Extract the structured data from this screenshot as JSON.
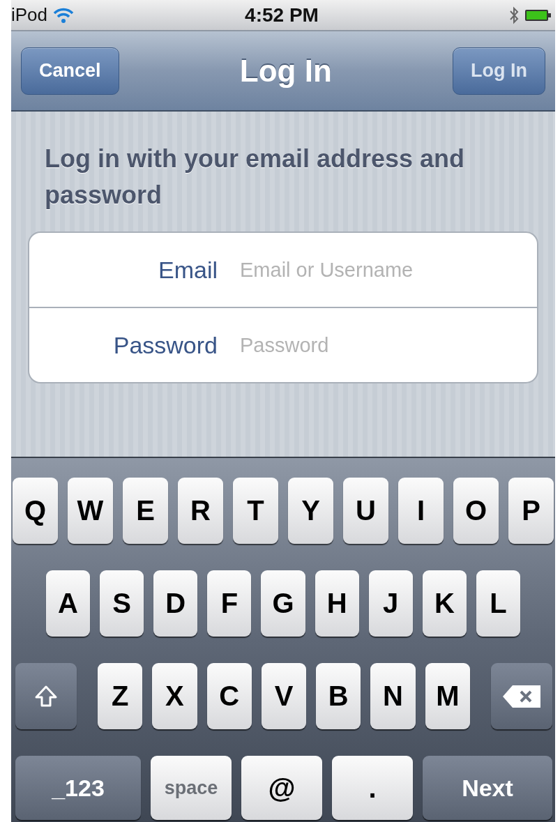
{
  "status_bar": {
    "carrier": "iPod",
    "time": "4:52 PM"
  },
  "nav_bar": {
    "left_button": "Cancel",
    "title": "Log In",
    "right_button": "Log In"
  },
  "instructions": "Log in with your email address and password",
  "fields": [
    {
      "label": "Email",
      "placeholder": "Email or Username"
    },
    {
      "label": "Password",
      "placeholder": "Password"
    }
  ],
  "keyboard": {
    "rows": [
      {
        "keys": [
          {
            "kind": "letter",
            "label": "Q"
          },
          {
            "kind": "letter",
            "label": "W"
          },
          {
            "kind": "letter",
            "label": "E"
          },
          {
            "kind": "letter",
            "label": "R"
          },
          {
            "kind": "letter",
            "label": "T"
          },
          {
            "kind": "letter",
            "label": "Y"
          },
          {
            "kind": "letter",
            "label": "U"
          },
          {
            "kind": "letter",
            "label": "I"
          },
          {
            "kind": "letter",
            "label": "O"
          },
          {
            "kind": "letter",
            "label": "P"
          }
        ]
      },
      {
        "keys": [
          {
            "kind": "letter",
            "label": "A"
          },
          {
            "kind": "letter",
            "label": "S"
          },
          {
            "kind": "letter",
            "label": "D"
          },
          {
            "kind": "letter",
            "label": "F"
          },
          {
            "kind": "letter",
            "label": "G"
          },
          {
            "kind": "letter",
            "label": "H"
          },
          {
            "kind": "letter",
            "label": "J"
          },
          {
            "kind": "letter",
            "label": "K"
          },
          {
            "kind": "letter",
            "label": "L"
          }
        ]
      },
      {
        "keys": [
          {
            "kind": "shift"
          },
          {
            "kind": "letter",
            "label": "Z"
          },
          {
            "kind": "letter",
            "label": "X"
          },
          {
            "kind": "letter",
            "label": "C"
          },
          {
            "kind": "letter",
            "label": "V"
          },
          {
            "kind": "letter",
            "label": "B"
          },
          {
            "kind": "letter",
            "label": "N"
          },
          {
            "kind": "letter",
            "label": "M"
          },
          {
            "kind": "delete"
          }
        ]
      },
      {
        "keys": [
          {
            "kind": "mode",
            "label": "_123"
          },
          {
            "kind": "space",
            "label": "space"
          },
          {
            "kind": "char",
            "label": "@"
          },
          {
            "kind": "char",
            "label": "."
          },
          {
            "kind": "return",
            "label": "Next"
          }
        ]
      }
    ]
  }
}
